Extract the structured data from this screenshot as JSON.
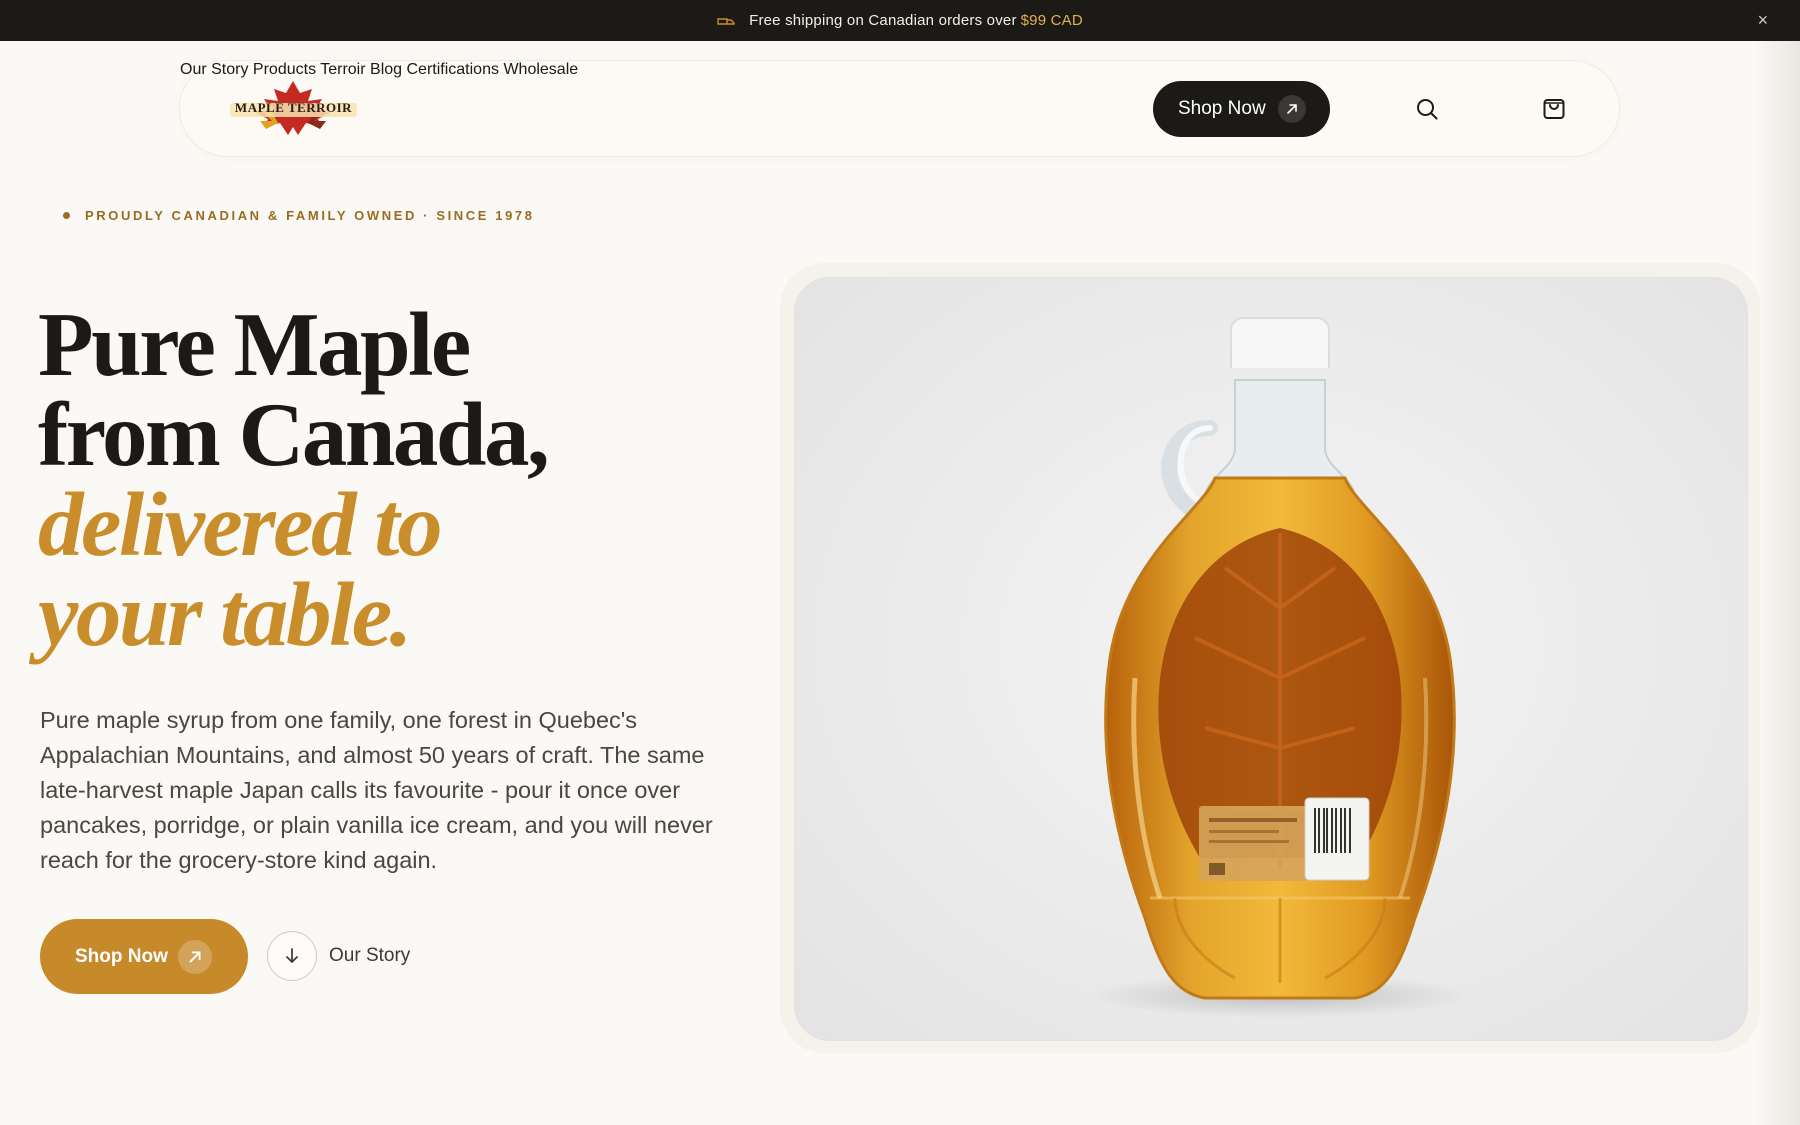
{
  "announcement": {
    "text": "Free shipping on Canadian orders over",
    "highlight": "$99 CAD",
    "close_label": "×"
  },
  "brand": {
    "logo_text": "MAPLE TERROIR",
    "accent_color": "#c68a2a",
    "dark_color": "#1c1a17"
  },
  "nav": {
    "items": [
      {
        "label": "Our Story"
      },
      {
        "label": "Products"
      },
      {
        "label": "Terroir"
      },
      {
        "label": "Blog"
      },
      {
        "label": "Certifications"
      },
      {
        "label": "Wholesale"
      }
    ],
    "shop_label": "Shop Now",
    "search_icon": "search-icon",
    "cart_icon": "shopping-bag-icon"
  },
  "hero": {
    "eyebrow": "PROUDLY CANADIAN & FAMILY OWNED · SINCE 1978",
    "headline": {
      "line1": "Pure Maple",
      "line2": "from Canada,",
      "line3": "delivered to",
      "line4": "your table."
    },
    "lede": "Pure maple syrup from one family, one forest in Quebec's Appalachian Mountains, and almost 50 years of craft. The same late-harvest maple Japan calls its favourite - pour it once over pancakes, porridge, or plain vanilla ice cream, and you will never reach for the grocery-store kind again.",
    "primary_cta": "Shop Now",
    "secondary_cta": "Our Story"
  }
}
